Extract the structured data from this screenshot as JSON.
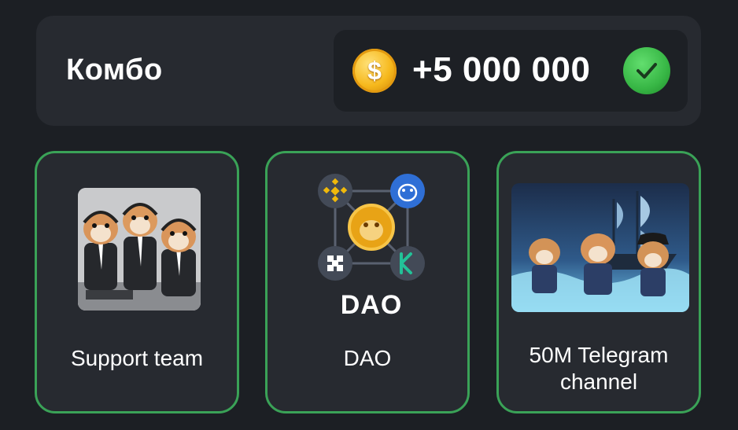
{
  "combo": {
    "title": "Комбо",
    "reward_symbol": "$",
    "reward_amount": "+5 000 000",
    "status": "completed"
  },
  "cards": [
    {
      "label": "Support team",
      "image": "hamsters-in-suits-headsets"
    },
    {
      "label": "DAO",
      "image_text": "DAO",
      "image": "dao-network-logos"
    },
    {
      "label": "50M Telegram channel",
      "image": "pirate-hamsters-ship"
    }
  ],
  "colors": {
    "background": "#1c1f24",
    "panel": "#272a30",
    "card_border": "#3aa257",
    "coin": "#f6b81c",
    "check": "#37b645"
  }
}
